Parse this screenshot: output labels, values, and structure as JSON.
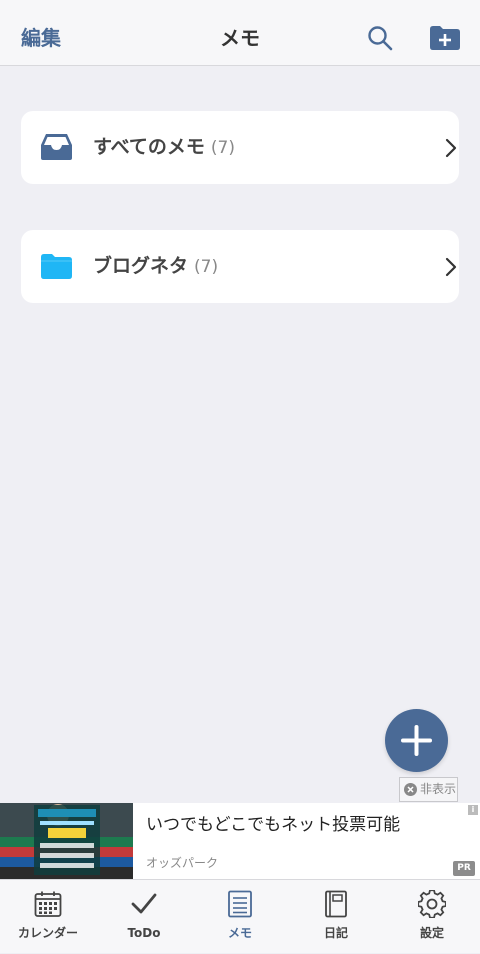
{
  "header": {
    "edit_label": "編集",
    "title": "メモ",
    "search_icon": "search-icon",
    "new_folder_icon": "folder-plus-icon"
  },
  "folders": [
    {
      "name": "すべてのメモ",
      "count": "(7)",
      "icon": "inbox-tray-icon",
      "color": "#4a6a96"
    },
    {
      "name": "ブログネタ",
      "count": "(7)",
      "icon": "folder-icon",
      "color": "#1fb6f5"
    }
  ],
  "fab": {
    "icon": "plus-icon",
    "color": "#4a6a96"
  },
  "hide_ad": {
    "label": "非表示"
  },
  "ad": {
    "headline": "いつでもどこでもネット投票可能",
    "advertiser": "オッズパーク",
    "badge": "PR",
    "info": "i"
  },
  "tabs": [
    {
      "label": "カレンダー",
      "icon": "calendar-icon",
      "active": false
    },
    {
      "label": "ToDo",
      "icon": "checkmark-icon",
      "active": false
    },
    {
      "label": "メモ",
      "icon": "memo-icon",
      "active": true
    },
    {
      "label": "日記",
      "icon": "notebook-icon",
      "active": false
    },
    {
      "label": "設定",
      "icon": "gear-icon",
      "active": false
    }
  ],
  "colors": {
    "accent": "#4a6a96",
    "folder_blue": "#1fb6f5",
    "background": "#efeff4"
  }
}
